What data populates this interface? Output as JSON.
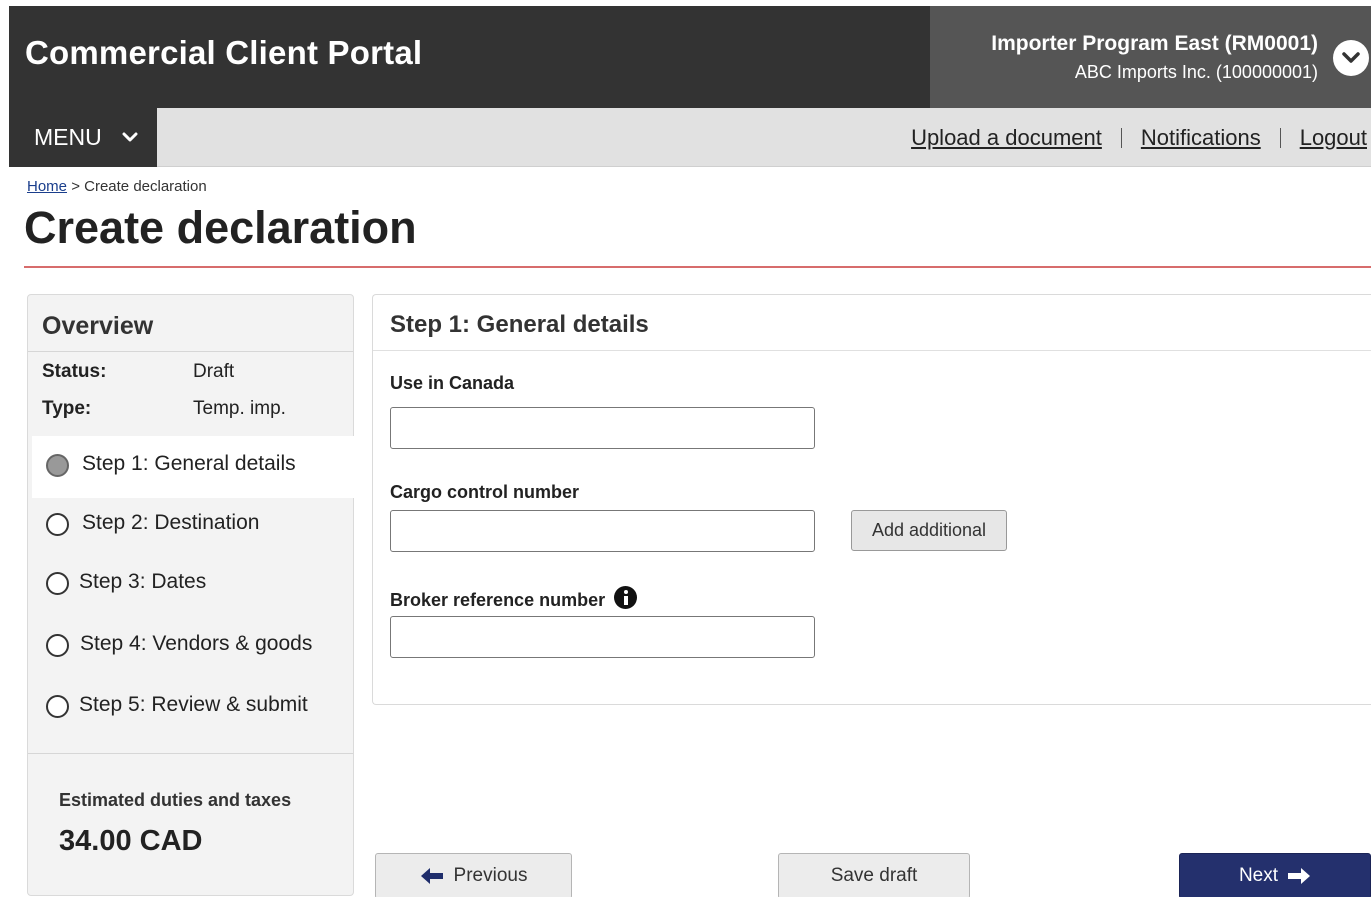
{
  "header": {
    "brand": "Commercial Client Portal",
    "account_program": "Importer Program East (RM0001)",
    "account_company": "ABC Imports Inc. (100000001)"
  },
  "nav": {
    "menu_label": "MENU",
    "links": [
      "Upload a document",
      "Notifications",
      "Logout"
    ]
  },
  "breadcrumb": {
    "home": "Home",
    "separator": ">",
    "current": "Create declaration"
  },
  "page_title": "Create declaration",
  "overview": {
    "title": "Overview",
    "status_label": "Status:",
    "status_value": "Draft",
    "type_label": "Type:",
    "type_value": "Temp. imp.",
    "steps": [
      {
        "label": "Step 1: General details",
        "active": true
      },
      {
        "label": "Step 2: Destination",
        "active": false
      },
      {
        "label": "Step 3: Dates",
        "active": false
      },
      {
        "label": "Step 4: Vendors & goods",
        "active": false
      },
      {
        "label": "Step 5: Review & submit",
        "active": false
      }
    ],
    "estimate_label": "Estimated duties and taxes",
    "estimate_value": "34.00 CAD"
  },
  "form": {
    "title": "Step 1: General details",
    "use_in_canada": {
      "label": "Use in Canada",
      "value": ""
    },
    "cargo_control_number": {
      "label": "Cargo control number",
      "value": ""
    },
    "add_additional_label": "Add additional",
    "broker_reference_number": {
      "label": "Broker reference number",
      "value": ""
    }
  },
  "actions": {
    "previous": "Previous",
    "save_draft": "Save draft",
    "next": "Next"
  },
  "colors": {
    "header_bg": "#333333",
    "account_bg": "#555555",
    "nav_bg": "#e1e1e1",
    "title_rule": "#d76c6c",
    "primary_button": "#24306d",
    "link": "#1a3e8c"
  },
  "icons": [
    "chevron-down-icon",
    "info-icon",
    "arrow-left-icon",
    "arrow-right-icon"
  ]
}
